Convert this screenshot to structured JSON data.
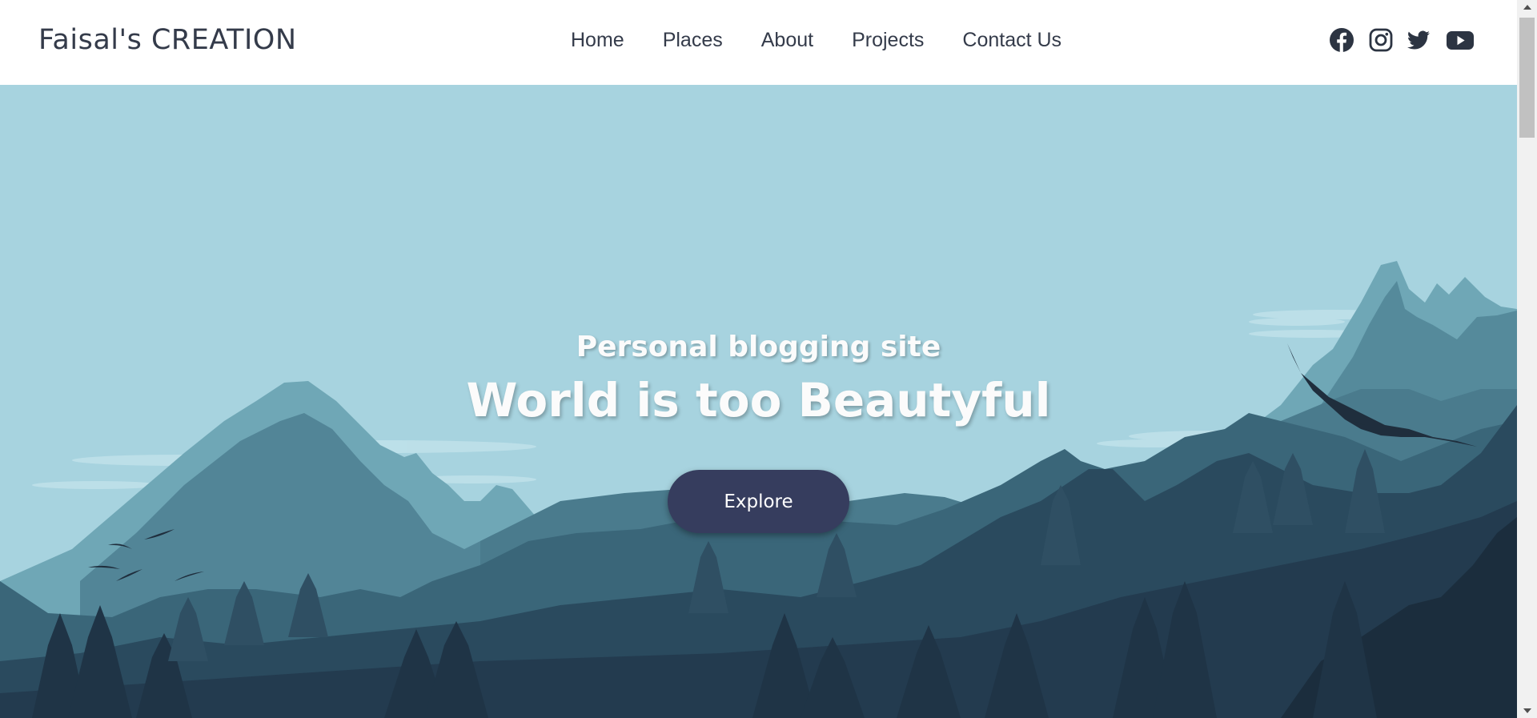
{
  "navbar": {
    "brand": "Faisal's CREATION",
    "links": [
      "Home",
      "Places",
      "About",
      "Projects",
      "Contact Us"
    ],
    "social": [
      "facebook-icon",
      "instagram-icon",
      "twitter-icon",
      "youtube-icon"
    ]
  },
  "hero": {
    "subtitle": "Personal blogging site",
    "title": "World is too Beautyful",
    "button": "Explore"
  },
  "colors": {
    "sky": "#a7d3df",
    "button": "#363d5e",
    "nav_text": "#343b4a"
  }
}
